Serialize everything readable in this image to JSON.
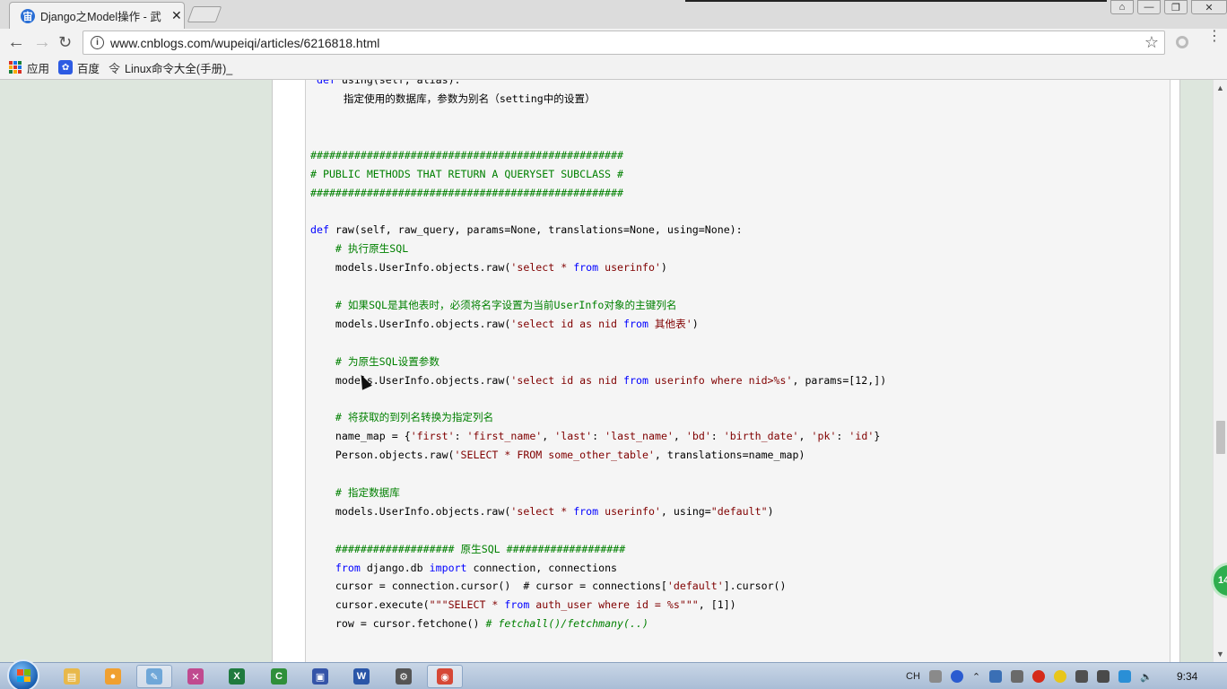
{
  "browser": {
    "tab_title": "Django之Model操作 - 武",
    "tab_favicon": "宙",
    "url": "www.cnblogs.com/wupeiqi/articles/6216818.html",
    "bookmarks": [
      {
        "label": "应用",
        "icon": "apps-icon"
      },
      {
        "label": "百度",
        "icon": "baidu-icon"
      },
      {
        "label": "Linux命令大全(手册)_",
        "icon": "linux-icon"
      }
    ]
  },
  "code": {
    "lines": [
      {
        "text": " def using(self, alias):",
        "style": "plain",
        "clip": true
      },
      {
        "text": "    指定使用的数据库，参数为别名（setting中的设置）",
        "style": "plain"
      },
      {
        "text": "",
        "style": "plain"
      },
      {
        "text": "",
        "style": "plain"
      },
      {
        "text": "##################################################",
        "style": "comment"
      },
      {
        "text": "# PUBLIC METHODS THAT RETURN A QUERYSET SUBCLASS #",
        "style": "comment"
      },
      {
        "text": "##################################################",
        "style": "comment"
      },
      {
        "text": "",
        "style": "plain"
      },
      {
        "text": "def raw(self, raw_query, params=None, translations=None, using=None):",
        "style": "def"
      },
      {
        "text": "    # 执行原生SQL",
        "style": "comment"
      },
      {
        "text": "    models.UserInfo.objects.raw('select * from userinfo')",
        "style": "str"
      },
      {
        "text": "",
        "style": "plain"
      },
      {
        "text": "    # 如果SQL是其他表时，必须将名字设置为当前UserInfo对象的主键列名",
        "style": "comment"
      },
      {
        "text": "    models.UserInfo.objects.raw('select id as nid from 其他表')",
        "style": "str"
      },
      {
        "text": "",
        "style": "plain"
      },
      {
        "text": "    # 为原生SQL设置参数",
        "style": "comment"
      },
      {
        "text": "    models.UserInfo.objects.raw('select id as nid from userinfo where nid>%s', params=[12,])",
        "style": "str"
      },
      {
        "text": "",
        "style": "plain"
      },
      {
        "text": "    # 将获取的到列名转换为指定列名",
        "style": "comment"
      },
      {
        "text": "    name_map = {'first': 'first_name', 'last': 'last_name', 'bd': 'birth_date', 'pk': 'id'}",
        "style": "str"
      },
      {
        "text": "    Person.objects.raw('SELECT * FROM some_other_table', translations=name_map)",
        "style": "str"
      },
      {
        "text": "",
        "style": "plain"
      },
      {
        "text": "    # 指定数据库",
        "style": "comment"
      },
      {
        "text": "    models.UserInfo.objects.raw('select * from userinfo', using=\"default\")",
        "style": "str"
      },
      {
        "text": "",
        "style": "plain"
      },
      {
        "text": "    ################### 原生SQL ###################",
        "style": "comment"
      },
      {
        "text": "    from django.db import connection, connections",
        "style": "import"
      },
      {
        "text": "    cursor = connection.cursor()  # cursor = connections['default'].cursor()",
        "style": "cursor"
      },
      {
        "text": "    cursor.execute(\"\"\"SELECT * from auth_user where id = %s\"\"\", [1])",
        "style": "str"
      },
      {
        "text": "    row = cursor.fetchone() # fetchall()/fetchmany(..)",
        "style": "fetch"
      }
    ]
  },
  "badge": {
    "text": "14"
  },
  "taskbar": {
    "apps": [
      {
        "icon": "file-explorer-icon",
        "color": "#e8b84a",
        "glyph": "▤"
      },
      {
        "icon": "paint-icon",
        "color": "#f0a030",
        "glyph": "●"
      },
      {
        "icon": "notepad-icon",
        "color": "#6fa7d8",
        "glyph": "✎"
      },
      {
        "icon": "tool-icon",
        "color": "#c04a8f",
        "glyph": "✕"
      },
      {
        "icon": "excel-icon",
        "color": "#1f7a3e",
        "glyph": "X"
      },
      {
        "icon": "editor-icon",
        "color": "#2f8f3a",
        "glyph": "C"
      },
      {
        "icon": "floppy-icon",
        "color": "#3454a8",
        "glyph": "▣"
      },
      {
        "icon": "word-icon",
        "color": "#2a56a8",
        "glyph": "W"
      },
      {
        "icon": "settings-icon",
        "color": "#555555",
        "glyph": "⚙"
      },
      {
        "icon": "chrome-icon",
        "color": "#d64836",
        "glyph": "◉"
      }
    ],
    "tray": {
      "lang": "CH",
      "time": "9:34"
    }
  }
}
